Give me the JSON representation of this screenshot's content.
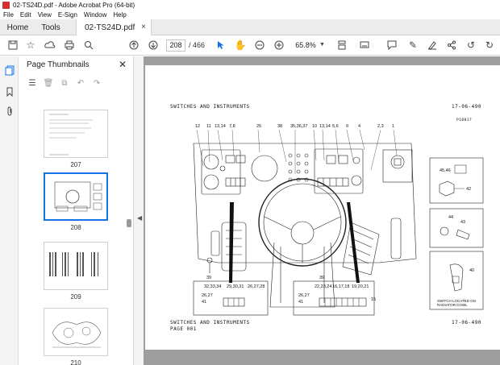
{
  "window": {
    "title": "02-TS24D.pdf - Adobe Acrobat Pro (64-bit)"
  },
  "menu": [
    "File",
    "Edit",
    "View",
    "E-Sign",
    "Window",
    "Help"
  ],
  "tabs": {
    "home": "Home",
    "tools": "Tools",
    "document": "02-TS24D.pdf"
  },
  "toolbar": {
    "current_page": "208",
    "page_separator": "/",
    "total_pages": "466",
    "zoom": "65.8%"
  },
  "thumbnails": {
    "title": "Page Thumbnails",
    "pages": [
      {
        "label": "207"
      },
      {
        "label": "208",
        "selected": true
      },
      {
        "label": "209"
      },
      {
        "label": "210"
      }
    ]
  },
  "document": {
    "header_left": "SWITCHES AND INSTRUMENTS",
    "header_right": "17-06-490",
    "figure_ref": "P10037",
    "footer_line1": "SWITCHES AND INSTRUMENTS",
    "footer_line2": "PAGE 001",
    "footer_right": "17-06-490",
    "callouts": {
      "c12": "12",
      "c11": "11",
      "c1314": "13,14",
      "c78": "7,8",
      "c25": "25",
      "c38": "38",
      "c353637": "35,36,37",
      "c10": "10",
      "c1314b": "13,14",
      "c56": "5,6",
      "c9": "9",
      "c4": "4",
      "c23": "2,3",
      "c1": "1",
      "c4546": "45,46",
      "c42": "42",
      "c44": "44",
      "c43": "43",
      "c40": "40",
      "c39a": "39",
      "c39b": "39",
      "c323334": "32,33,34",
      "c293031": "29,30,31",
      "c262728": "26,27,28",
      "c2627": "26,27",
      "c41": "41",
      "c222324": "22,23,24",
      "c161718": "16,17,18",
      "c192021": "19,20,21",
      "c2627b": "26,27",
      "c41b": "41",
      "c15": "15"
    },
    "note_switch": "SWITCH LOCATED ON",
    "note_switch2": "RADIATOR COWL"
  }
}
